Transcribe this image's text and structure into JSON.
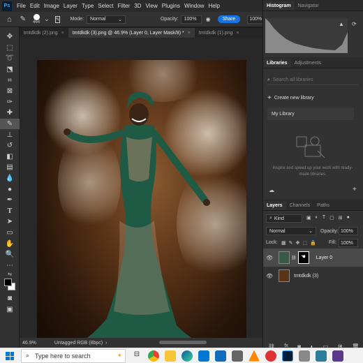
{
  "menubar": {
    "items": [
      "File",
      "Edit",
      "Image",
      "Layer",
      "Type",
      "Select",
      "Filter",
      "3D",
      "View",
      "Plugins",
      "Window",
      "Help"
    ]
  },
  "options": {
    "brush_size": "464",
    "mode_label": "Mode:",
    "mode_value": "Normal",
    "opacity_label": "Opacity:",
    "opacity_value": "100%",
    "share_label": "Share",
    "zoom_value": "100%"
  },
  "tabs": [
    {
      "label": "tmtdkdk (2).png",
      "active": false
    },
    {
      "label": "tmtdkdk (3).png @ 46.9% (Layer 0, Layer Mask/8) *",
      "active": true
    },
    {
      "label": "tmtdkdk (1).png",
      "active": false
    }
  ],
  "status": {
    "zoom": "46.9%",
    "color_profile": "Untagged RGB (8bpc)"
  },
  "histogram_panel": {
    "tabs": [
      "Histogram",
      "Navigator"
    ]
  },
  "libraries_panel": {
    "tabs": [
      "Libraries",
      "Adjustments"
    ],
    "search_placeholder": "Search all libraries",
    "create_label": "Create new library",
    "library_name": "My Library",
    "hint": "Inspire and speed up your work with ready-made libraries."
  },
  "layers_panel": {
    "tabs": [
      "Layers",
      "Channels",
      "Paths"
    ],
    "kind_label": "Kind",
    "blend_mode": "Normal",
    "opacity_label": "Opacity:",
    "opacity_value": "100%",
    "lock_label": "Lock:",
    "fill_label": "Fill:",
    "fill_value": "100%",
    "layers": [
      {
        "name": "Layer 0",
        "selected": true
      },
      {
        "name": "tmtdkdk (3)",
        "selected": false
      }
    ]
  },
  "taskbar": {
    "search_placeholder": "Type here to search"
  },
  "colors": {
    "accent": "#1473e6",
    "dress": "#1f5a45"
  }
}
